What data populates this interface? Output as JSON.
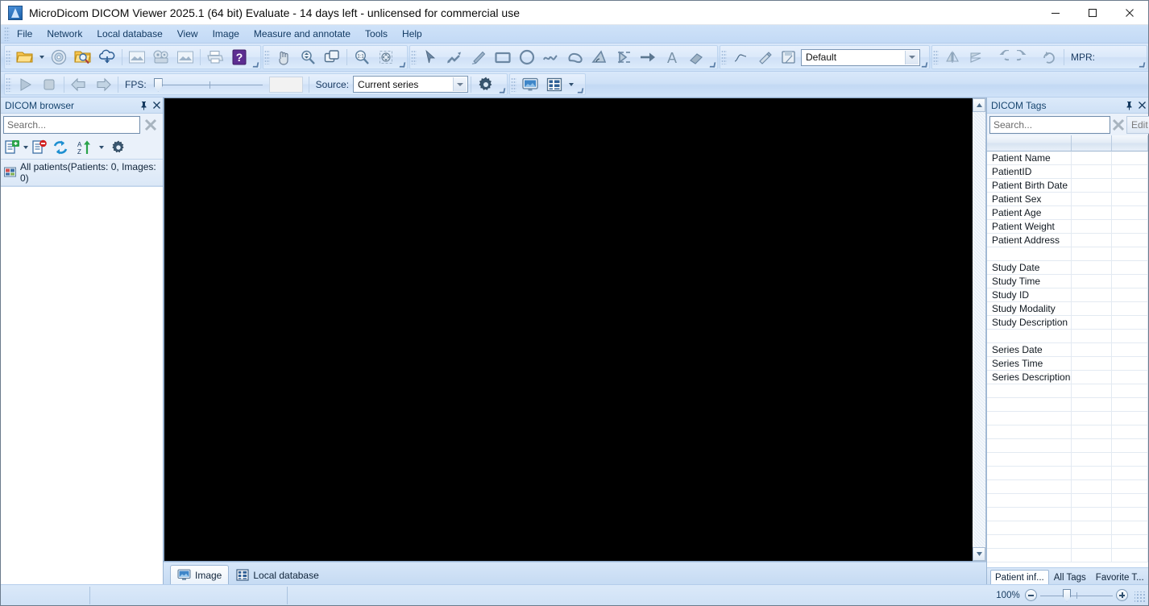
{
  "window": {
    "title": "MicroDicom DICOM Viewer 2025.1 (64 bit) Evaluate - 14 days left - unlicensed for commercial use",
    "app_icon": "app-logo-icon",
    "minimize": "minimize-icon",
    "maximize": "maximize-icon",
    "close": "close-icon"
  },
  "menubar": {
    "items": [
      {
        "label": "File"
      },
      {
        "label": "Network"
      },
      {
        "label": "Local database"
      },
      {
        "label": "View"
      },
      {
        "label": "Image"
      },
      {
        "label": "Measure and annotate"
      },
      {
        "label": "Tools"
      },
      {
        "label": "Help"
      }
    ]
  },
  "toolbar_row1": {
    "group_file": {
      "buttons": [
        {
          "name": "open-folder-icon",
          "tooltip": "Open"
        },
        {
          "name": "open-cd-icon",
          "tooltip": "Open CD"
        },
        {
          "name": "search-folder-icon",
          "tooltip": "Scan folder"
        },
        {
          "name": "cloud-download-icon",
          "tooltip": "Download"
        },
        {
          "name": "export-image-icon",
          "tooltip": "Export image"
        },
        {
          "name": "export-video-icon",
          "tooltip": "Export video"
        },
        {
          "name": "export-image2-icon",
          "tooltip": "Export"
        },
        {
          "name": "print-icon",
          "tooltip": "Print"
        },
        {
          "name": "help-icon",
          "tooltip": "Help"
        }
      ]
    },
    "group_navigate": {
      "buttons": [
        {
          "name": "pan-hand-icon",
          "tooltip": "Pan"
        },
        {
          "name": "zoom-icon",
          "tooltip": "Zoom"
        },
        {
          "name": "copy-window-icon",
          "tooltip": "Duplicate"
        },
        {
          "name": "zoom-one-to-one-icon",
          "tooltip": "1:1 zoom"
        },
        {
          "name": "fit-to-window-icon",
          "tooltip": "Fit to window"
        }
      ]
    },
    "group_annotate": {
      "buttons": [
        {
          "name": "pointer-icon",
          "tooltip": "Select"
        },
        {
          "name": "measure-length-icon",
          "tooltip": "Length"
        },
        {
          "name": "freehand-icon",
          "tooltip": "Freehand"
        },
        {
          "name": "rectangle-icon",
          "tooltip": "Rectangle"
        },
        {
          "name": "ellipse-icon",
          "tooltip": "Ellipse"
        },
        {
          "name": "polyline-icon",
          "tooltip": "Polyline"
        },
        {
          "name": "closed-curve-icon",
          "tooltip": "Closed curve"
        },
        {
          "name": "angle-icon",
          "tooltip": "Angle"
        },
        {
          "name": "cobb-angle-icon",
          "tooltip": "Cobb angle"
        },
        {
          "name": "arrow-icon",
          "tooltip": "Arrow"
        },
        {
          "name": "text-icon",
          "tooltip": "Text"
        },
        {
          "name": "eraser-icon",
          "tooltip": "Erase"
        }
      ]
    },
    "group_preset": {
      "buttons": [
        {
          "name": "curve-icon",
          "tooltip": "Window curve"
        },
        {
          "name": "highlighter-icon",
          "tooltip": "Highlight"
        },
        {
          "name": "save-preset-icon",
          "tooltip": "Save preset"
        }
      ],
      "preset_combo": {
        "value": "Default",
        "options": [
          "Default"
        ]
      }
    },
    "group_transform": {
      "buttons": [
        {
          "name": "flip-horizontal-icon",
          "tooltip": "Flip horizontal"
        },
        {
          "name": "flip-vertical-icon",
          "tooltip": "Flip vertical"
        },
        {
          "name": "rotate-left-icon",
          "tooltip": "Rotate left"
        },
        {
          "name": "rotate-right-icon",
          "tooltip": "Rotate right"
        },
        {
          "name": "reset-rotation-icon",
          "tooltip": "Reset"
        }
      ],
      "mpr_label": "MPR:"
    }
  },
  "toolbar_row2": {
    "playback": {
      "play": "play-icon",
      "stop": "stop-icon",
      "prev": "previous-icon",
      "next": "next-icon",
      "fps_label": "FPS:",
      "fps_value": ""
    },
    "source": {
      "label": "Source:",
      "combo": {
        "value": "Current series",
        "options": [
          "Current series"
        ]
      },
      "settings": "gear-icon"
    },
    "layout": {
      "single_view": "single-view-icon",
      "grid_view": "grid-layout-icon",
      "dropdown": "chevron-down-icon"
    }
  },
  "left_panel": {
    "title": "DICOM browser",
    "pin": "pin-icon",
    "close": "close-icon",
    "search": {
      "placeholder": "Search...",
      "value": ""
    },
    "clear": "clear-search-icon",
    "toolbar": [
      {
        "name": "add-patient-icon"
      },
      {
        "name": "remove-patient-icon"
      },
      {
        "name": "refresh-icon"
      },
      {
        "name": "sort-az-icon"
      },
      {
        "name": "settings-gear-icon"
      }
    ],
    "root_node": {
      "icon": "all-patients-icon",
      "label": "All patients(Patients: 0, Images: 0)"
    }
  },
  "center": {
    "viewport_background": "#000000",
    "scrollbar": {
      "up": "scroll-up-icon",
      "down": "scroll-down-icon"
    },
    "tabs": [
      {
        "label": "Image",
        "icon": "monitor-icon",
        "active": true
      },
      {
        "label": "Local database",
        "icon": "database-grid-icon",
        "active": false
      }
    ]
  },
  "right_panel": {
    "title": "DICOM Tags",
    "pin": "pin-icon",
    "close": "close-icon",
    "search": {
      "placeholder": "Search...",
      "value": ""
    },
    "clear": "clear-search-icon",
    "edit_label": "Edit",
    "columns": [
      "",
      "",
      ""
    ],
    "rows": [
      {
        "name": "Patient Name",
        "vr": "",
        "value": ""
      },
      {
        "name": "PatientID",
        "vr": "",
        "value": ""
      },
      {
        "name": "Patient Birth Date",
        "vr": "",
        "value": ""
      },
      {
        "name": "Patient Sex",
        "vr": "",
        "value": ""
      },
      {
        "name": "Patient Age",
        "vr": "",
        "value": ""
      },
      {
        "name": "Patient Weight",
        "vr": "",
        "value": ""
      },
      {
        "name": "Patient Address",
        "vr": "",
        "value": ""
      },
      {
        "name": "",
        "vr": "",
        "value": ""
      },
      {
        "name": "Study Date",
        "vr": "",
        "value": ""
      },
      {
        "name": "Study Time",
        "vr": "",
        "value": ""
      },
      {
        "name": "Study ID",
        "vr": "",
        "value": ""
      },
      {
        "name": "Study Modality",
        "vr": "",
        "value": ""
      },
      {
        "name": "Study Description",
        "vr": "",
        "value": ""
      },
      {
        "name": "",
        "vr": "",
        "value": ""
      },
      {
        "name": "Series Date",
        "vr": "",
        "value": ""
      },
      {
        "name": "Series Time",
        "vr": "",
        "value": ""
      },
      {
        "name": "Series Description",
        "vr": "",
        "value": ""
      },
      {
        "name": "",
        "vr": "",
        "value": ""
      },
      {
        "name": "",
        "vr": "",
        "value": ""
      },
      {
        "name": "",
        "vr": "",
        "value": ""
      },
      {
        "name": "",
        "vr": "",
        "value": ""
      },
      {
        "name": "",
        "vr": "",
        "value": ""
      },
      {
        "name": "",
        "vr": "",
        "value": ""
      },
      {
        "name": "",
        "vr": "",
        "value": ""
      },
      {
        "name": "",
        "vr": "",
        "value": ""
      },
      {
        "name": "",
        "vr": "",
        "value": ""
      },
      {
        "name": "",
        "vr": "",
        "value": ""
      },
      {
        "name": "",
        "vr": "",
        "value": ""
      },
      {
        "name": "",
        "vr": "",
        "value": ""
      },
      {
        "name": "",
        "vr": "",
        "value": ""
      }
    ],
    "tabs": [
      {
        "label": "Patient inf...",
        "active": true
      },
      {
        "label": "All Tags",
        "active": false
      },
      {
        "label": "Favorite T...",
        "active": false
      }
    ]
  },
  "statusbar": {
    "cell1": "",
    "cell2": "",
    "cell3": "",
    "zoom_percent": "100%",
    "zoom_out": "zoom-out-icon",
    "zoom_in": "zoom-in-icon"
  },
  "colors": {
    "accent": "#1b4f87",
    "toolbar_bg": "#cfe2f8",
    "viewport": "#000000",
    "text": "#10243a"
  }
}
